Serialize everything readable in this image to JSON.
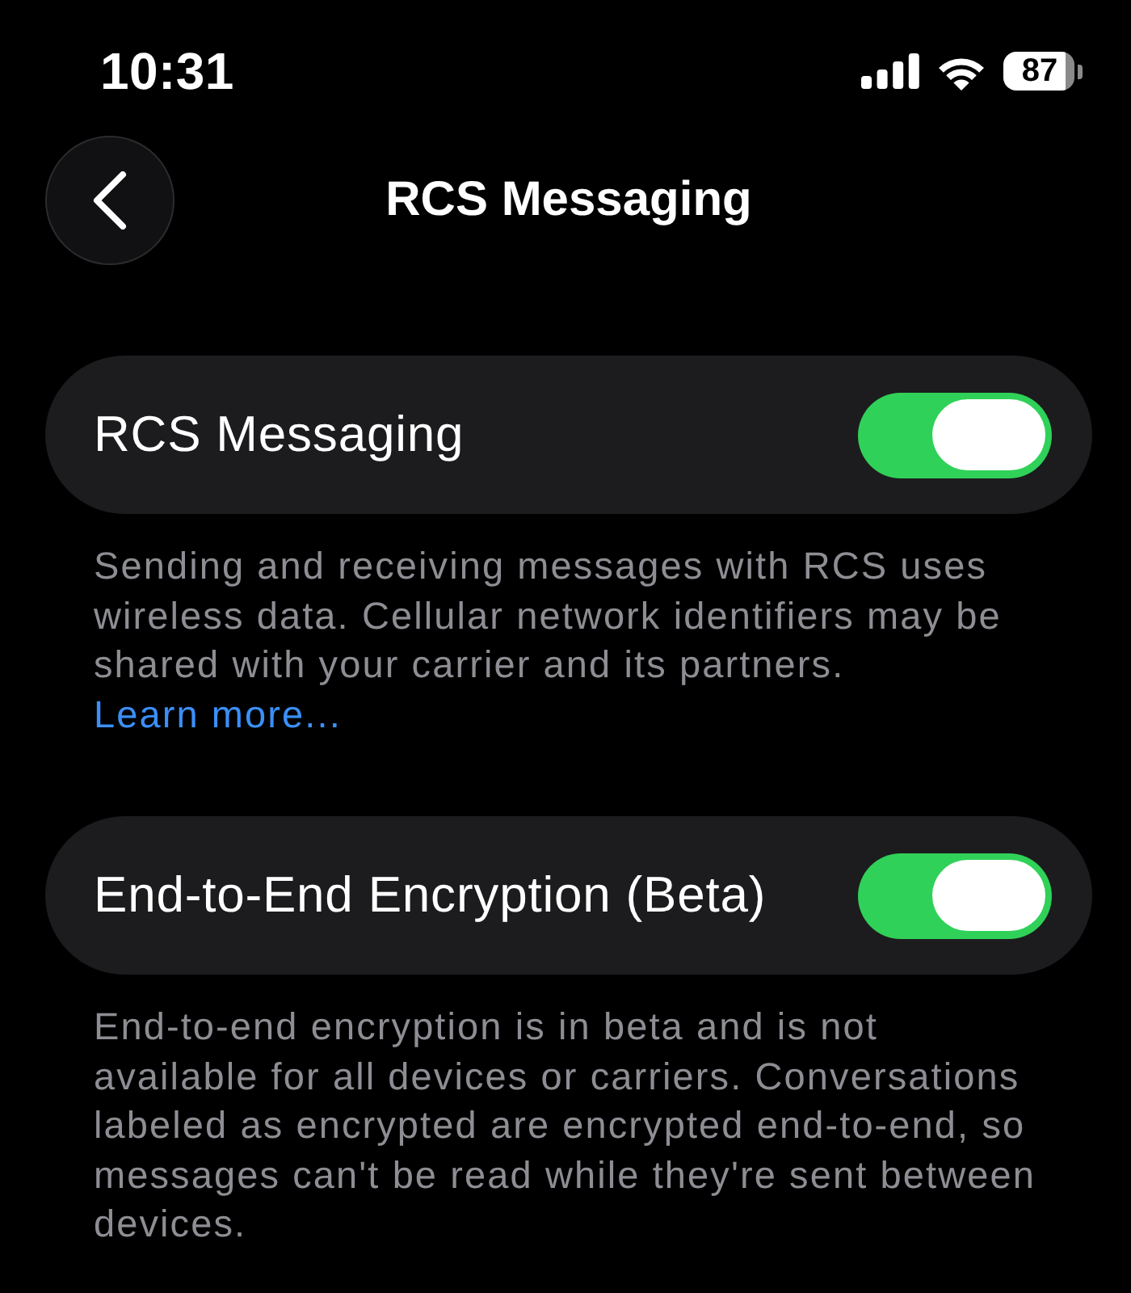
{
  "status_bar": {
    "time": "10:31",
    "battery": "87"
  },
  "nav": {
    "title": "RCS Messaging"
  },
  "sections": [
    {
      "label": "RCS Messaging",
      "on": true,
      "description": "Sending and receiving messages with RCS uses wireless data. Cellular network identifiers may be shared with your carrier and its partners.",
      "link": "Learn more..."
    },
    {
      "label": "End-to-End Encryption (Beta)",
      "on": true,
      "description": "End-to-end encryption is in beta and is not available for all devices or carriers. Conversations labeled as encrypted are encrypted end-to-end, so messages can't be read while they're sent between devices."
    }
  ]
}
